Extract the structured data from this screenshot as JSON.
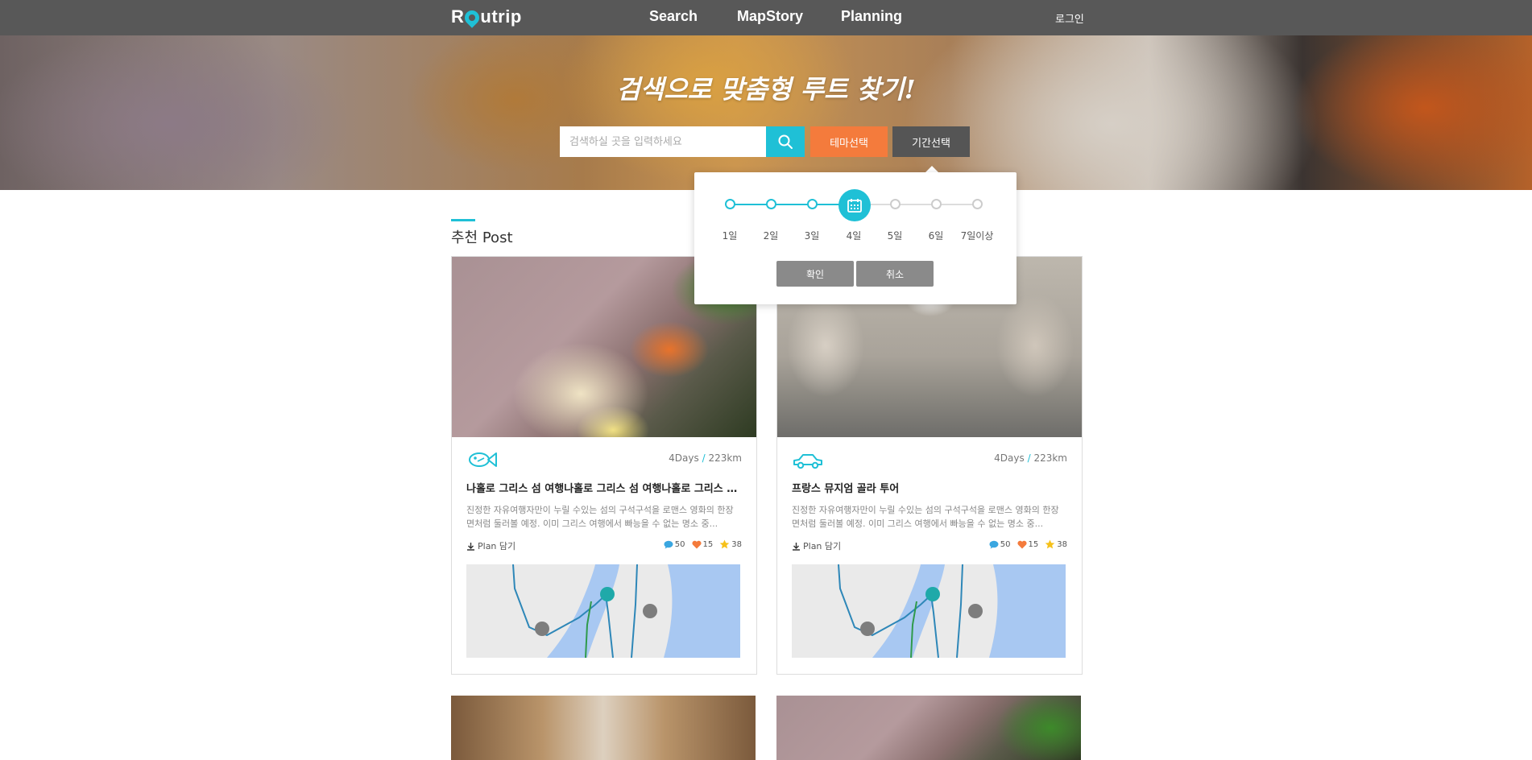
{
  "header": {
    "logo": "Routrip",
    "nav": [
      "Search",
      "MapStory",
      "Planning"
    ],
    "login": "로그인"
  },
  "hero": {
    "title": "검색으로 맞춤형 루트 찾기!",
    "search_placeholder": "검색하실 곳을 입력하세요",
    "theme_button": "테마선택",
    "period_button": "기간선택"
  },
  "period_popup": {
    "days": [
      "1일",
      "2일",
      "3일",
      "4일",
      "5일",
      "6일",
      "7일이상"
    ],
    "selected_index": 3,
    "confirm": "확인",
    "cancel": "취소"
  },
  "section": {
    "title": "추천 Post"
  },
  "cards": [
    {
      "icon": "fish-airplane-icon",
      "days": "4Days",
      "distance": "223km",
      "title": "나홀로 그리스 섬 여행나홀로 그리스 섬 여행나홀로 그리스 섬 여행",
      "desc": "진정한 자유여행자만이 누릴 수있는 섬의 구석구석을 로맨스 영화의 한장면처럼 둘러볼 예정. 이미 그리스 여행에서 빠능을 수 없는 명소 중...",
      "plan": "Plan 담기",
      "comments": "50",
      "likes": "15",
      "stars": "38"
    },
    {
      "icon": "car-icon",
      "days": "4Days",
      "distance": "223km",
      "title": "프랑스 뮤지엄 골라 투어",
      "desc": "진정한 자유여행자만이 누릴 수있는 섬의 구석구석을 로맨스 영화의 한장면처럼 둘러볼 예정. 이미 그리스 여행에서 빠능을 수 없는 명소 중...",
      "plan": "Plan 담기",
      "comments": "50",
      "likes": "15",
      "stars": "38"
    }
  ],
  "colors": {
    "accent": "#1fc0d6",
    "orange": "#f47b3c",
    "header": "#585858"
  }
}
